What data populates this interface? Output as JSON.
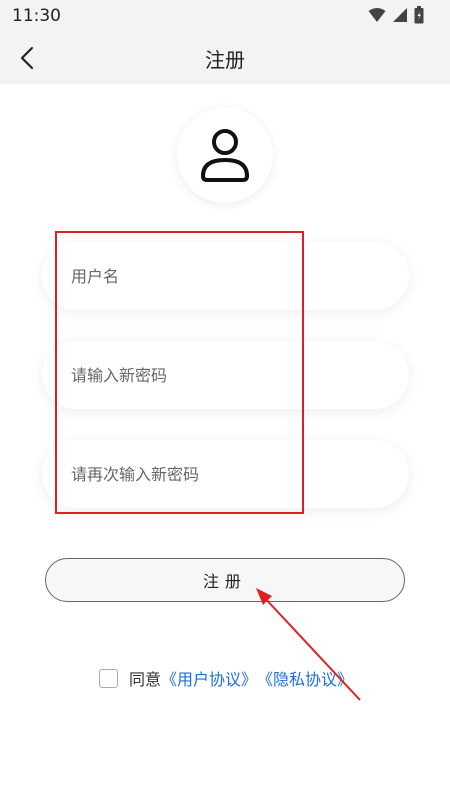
{
  "status_bar": {
    "time": "11:30"
  },
  "header": {
    "title": "注册"
  },
  "form": {
    "username_placeholder": "用户名",
    "password_placeholder": "请输入新密码",
    "confirm_password_placeholder": "请再次输入新密码"
  },
  "register_button": {
    "label": "注册"
  },
  "agreement": {
    "prefix": "同意",
    "user_agreement": "《用户协议》",
    "privacy_agreement": "《隐私协议》",
    "checked": false
  },
  "annotation_colors": {
    "highlight": "#e02020",
    "link": "#1e6fd9"
  }
}
